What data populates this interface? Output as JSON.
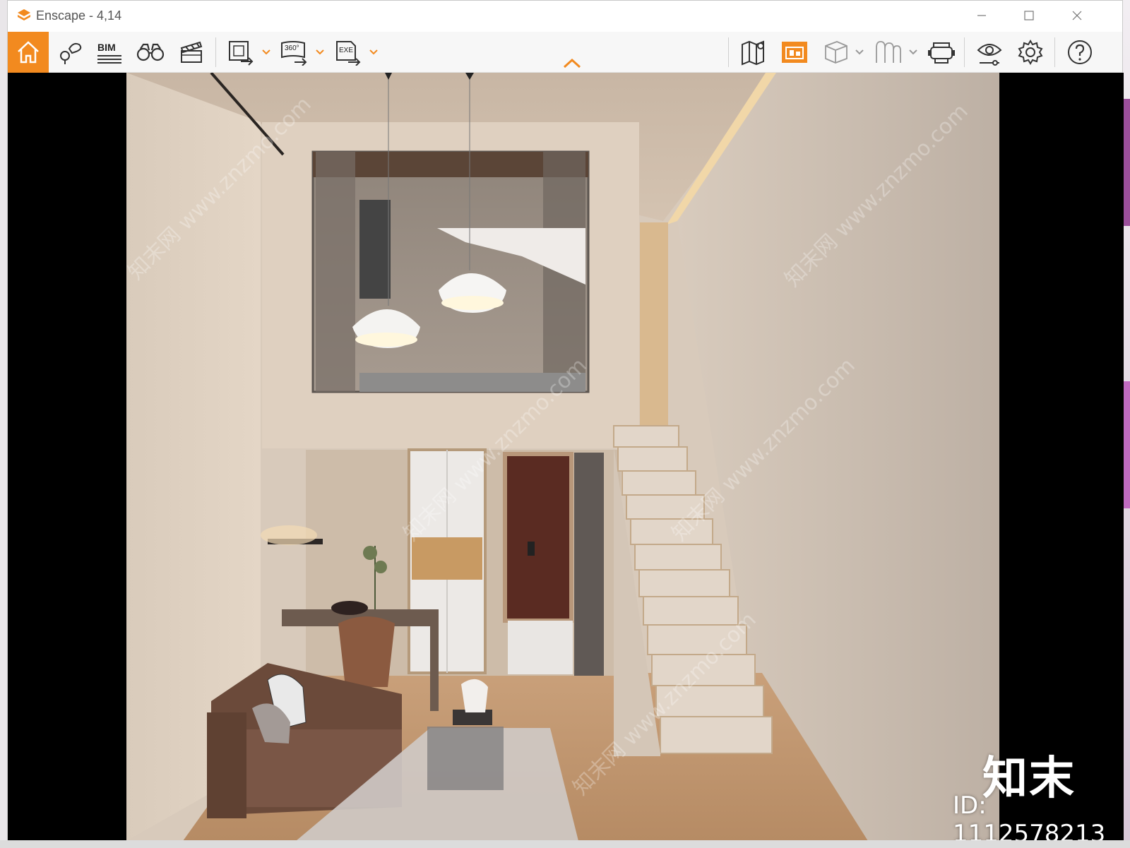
{
  "window": {
    "title": "Enscape - 4,14"
  },
  "toolbar": {
    "bim_label": "BIM",
    "panorama_label": "360°",
    "exe_label": "EXE"
  },
  "icons": {
    "home": "home-icon",
    "views": "views-icon",
    "bim": "bim-icon",
    "binoculars": "binoculars-icon",
    "video": "clapperboard-icon",
    "screenshot_export": "screenshot-export-icon",
    "panorama_export": "panorama-export-icon",
    "exe_export": "exe-export-icon",
    "map": "map-icon",
    "asset_library": "asset-library-icon",
    "material_editor": "cube-icon",
    "atmosphere": "atmosphere-icon",
    "vr": "vr-headset-icon",
    "visual_settings": "eye-icon",
    "settings": "gear-icon",
    "help": "help-icon"
  },
  "accent_color": "#f28a1f",
  "watermark": {
    "brand": "知末",
    "id": "ID: 1112578213",
    "diagonal": "知末网 www.znzmo.com"
  }
}
